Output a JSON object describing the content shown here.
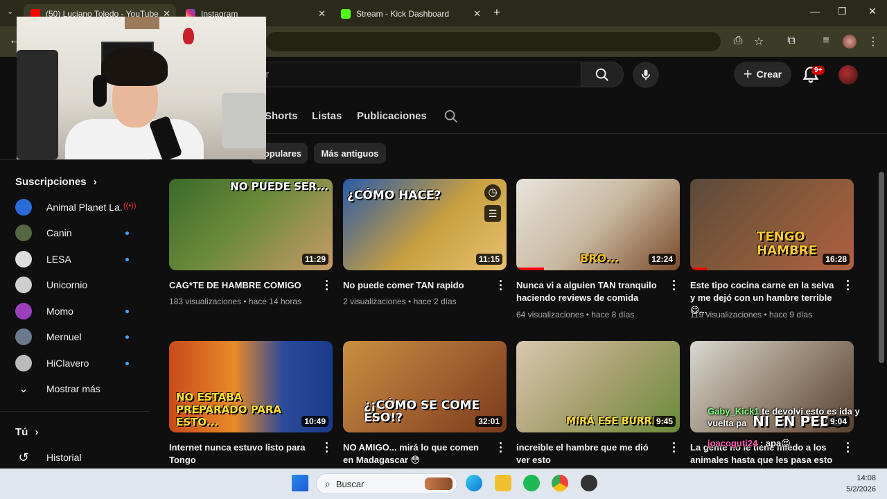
{
  "browser": {
    "tabs": [
      {
        "label": "(50) Luciano Toledo - YouTube",
        "favicon_color": "#ff0000"
      },
      {
        "label": "Instagram",
        "favicon_color": "#d62976"
      },
      {
        "label": "Stream - Kick Dashboard",
        "favicon_color": "#53fc18"
      }
    ],
    "new_tab": "+"
  },
  "youtube": {
    "search_placeholder": "ar",
    "create_label": "Crear",
    "notif_badge": "9+",
    "channel_tabs": [
      "Shorts",
      "Listas",
      "Publicaciones"
    ],
    "chips": [
      "opulares",
      "Más antiguos"
    ]
  },
  "sidebar": {
    "subs_title": "Suscripciones",
    "subs": [
      {
        "label": "Animal Planet La...",
        "color": "#2a6bd8",
        "live": true
      },
      {
        "label": "Canin",
        "color": "#556644",
        "dot": true
      },
      {
        "label": "LESA",
        "color": "#dddddd",
        "dot": true
      },
      {
        "label": "Unicornio",
        "color": "#cfcfcf",
        "dot": false
      },
      {
        "label": "Momo",
        "color": "#9b3fbf",
        "dot": true
      },
      {
        "label": "Mernuel",
        "color": "#6a7a8a",
        "dot": true
      },
      {
        "label": "HiClavero",
        "color": "#bbbbbb",
        "dot": true
      }
    ],
    "show_more": "Mostrar más",
    "you_title": "Tú",
    "history": "Historial"
  },
  "videos": [
    {
      "title": "CAG*TE DE HAMBRE COMIGO",
      "meta": "183 visualizaciones • hace 14 horas",
      "duration": "11:29",
      "overlay": "NO PUEDE SER...",
      "bg1": "#3a6a2a",
      "bg2": "#c89a6a"
    },
    {
      "title": "No puede comer TAN rapido",
      "meta": "2 visualizaciones • hace 2 días",
      "duration": "11:15",
      "overlay": "¿CÓMO HACE?",
      "bg1": "#2a5aa8",
      "bg2": "#e8c070"
    },
    {
      "title": "Nunca vi a alguien TAN tranquilo haciendo reviews de comida",
      "meta": "64 visualizaciones • hace 8 días",
      "duration": "12:24",
      "overlay": "BRO...",
      "bg1": "#e8e4dc",
      "bg2": "#7a4a2a"
    },
    {
      "title": "Este tipo cocina carne en la selva y me dejó con un hambre terrible 😋...",
      "meta": "119 visualizaciones • hace 9 días",
      "duration": "16:28",
      "overlay": "TENGO HAMBRE",
      "bg1": "#5a4a3a",
      "bg2": "#b06040"
    },
    {
      "title": "Internet nunca estuvo listo para Tongo",
      "meta": "",
      "duration": "10:49",
      "overlay": "NO ESTABA PREPARADO PARA ESTO...",
      "bg1": "#c84a1a",
      "bg2": "#1a3a8a"
    },
    {
      "title": "NO AMIGO... mirá lo que comen en Madagascar 😳",
      "meta": "",
      "duration": "32:01",
      "overlay": "¿¡CÓMO SE COME ESO!?",
      "bg1": "#c89040",
      "bg2": "#7a3a1a"
    },
    {
      "title": "increible el hambre que me dió ver esto",
      "meta": "",
      "duration": "9:45",
      "overlay": "MIRÁ ESE BURRITO",
      "bg1": "#d8c8b0",
      "bg2": "#6a8a3a"
    },
    {
      "title": "La gente no le tiene miedo a los animales hasta que les pasa esto",
      "meta": "",
      "duration": "9:04",
      "overlay": "NI EN PEDO",
      "bg1": "#d8d8d0",
      "bg2": "#5a4030"
    }
  ],
  "chat": [
    {
      "user": "Gaby_Kick1",
      "msg": "te devolvi esto es ida y vuelta pa",
      "user_color": "#7fff7f"
    },
    {
      "user": "joacoguti24",
      "msg": "apa😍",
      "user_color": "#ff5ab0"
    }
  ],
  "taskbar": {
    "search_label": "Buscar",
    "time": "14:08",
    "date": "5/2/2026"
  }
}
